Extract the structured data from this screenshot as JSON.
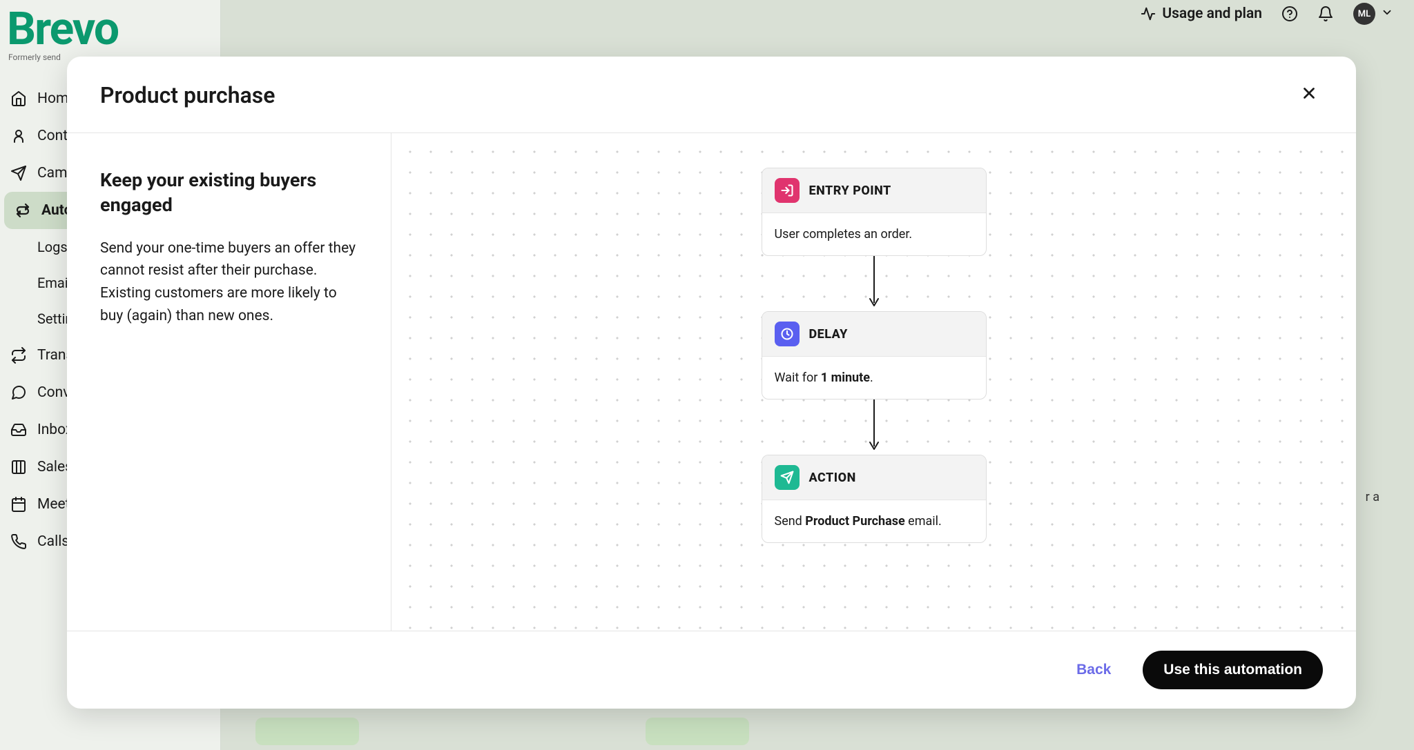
{
  "topbar": {
    "usage_label": "Usage and plan",
    "avatar_initials": "ML"
  },
  "logo": {
    "name": "Brevo",
    "sub": "Formerly send"
  },
  "sidebar": {
    "items": [
      {
        "label": "Home"
      },
      {
        "label": "Contacts"
      },
      {
        "label": "Campaigns"
      },
      {
        "label": "Automations"
      },
      {
        "label": "Logs"
      },
      {
        "label": "Email"
      },
      {
        "label": "Settings"
      },
      {
        "label": "Transactional"
      },
      {
        "label": "Conversations"
      },
      {
        "label": "Inbox"
      },
      {
        "label": "Sales"
      },
      {
        "label": "Meetings"
      },
      {
        "label": "Calls"
      }
    ]
  },
  "modal": {
    "title": "Product purchase",
    "heading": "Keep your existing buyers engaged",
    "description": "Send your one-time buyers an offer they cannot resist after their purchase. Existing customers are more likely to buy (again) than new ones.",
    "flow": {
      "entry": {
        "label": "ENTRY POINT",
        "text": "User completes an order."
      },
      "delay": {
        "label": "DELAY",
        "prefix": "Wait for ",
        "bold": "1 minute",
        "suffix": "."
      },
      "action": {
        "label": "ACTION",
        "prefix": "Send ",
        "bold": "Product Purchase",
        "suffix": " email."
      }
    },
    "back_label": "Back",
    "use_label": "Use this automation"
  },
  "bg": {
    "right_text": "r a"
  }
}
